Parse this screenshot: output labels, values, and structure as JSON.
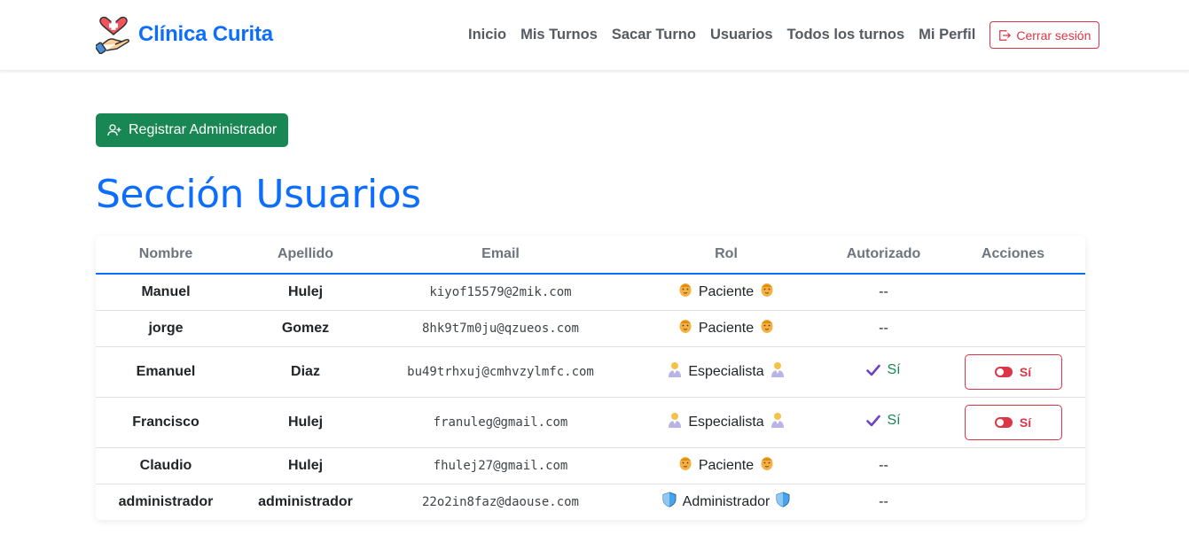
{
  "brand": {
    "name": "Clínica Curita",
    "logo_icon": "heart-hand-icon"
  },
  "nav": {
    "links": [
      "Inicio",
      "Mis Turnos",
      "Sacar Turno",
      "Usuarios",
      "Todos los turnos",
      "Mi Perfil"
    ],
    "logout_label": "Cerrar sesión"
  },
  "register_button": {
    "label": "Registrar Administrador",
    "icon": "person-plus-icon"
  },
  "page_title": "Sección Usuarios",
  "table": {
    "headers": [
      "Nombre",
      "Apellido",
      "Email",
      "Rol",
      "Autorizado",
      "Acciones"
    ],
    "rows": [
      {
        "name": "Manuel",
        "surname": "Hulej",
        "email": "kiyof15579@2mik.com",
        "rol": "Paciente",
        "rol_icon": "patient-emoji-icon",
        "authorized": "--",
        "action": null
      },
      {
        "name": "jorge",
        "surname": "Gomez",
        "email": "8hk9t7m0ju@qzueos.com",
        "rol": "Paciente",
        "rol_icon": "patient-emoji-icon",
        "authorized": "--",
        "action": null
      },
      {
        "name": "Emanuel",
        "surname": "Diaz",
        "email": "bu49trhxuj@cmhvzylmfc.com",
        "rol": "Especialista",
        "rol_icon": "doctor-emoji-icon",
        "authorized": "Sí",
        "action": "Sí"
      },
      {
        "name": "Francisco",
        "surname": "Hulej",
        "email": "franuleg@gmail.com",
        "rol": "Especialista",
        "rol_icon": "doctor-emoji-icon",
        "authorized": "Sí",
        "action": "Sí"
      },
      {
        "name": "Claudio",
        "surname": "Hulej",
        "email": "fhulej27@gmail.com",
        "rol": "Paciente",
        "rol_icon": "patient-emoji-icon",
        "authorized": "--",
        "action": null
      },
      {
        "name": "administrador",
        "surname": "administrador",
        "email": "22o2in8faz@daouse.com",
        "rol": "Administrador",
        "rol_icon": "shield-icon",
        "authorized": "--",
        "action": null
      }
    ]
  },
  "colors": {
    "primary": "#0d6efd",
    "success": "#198754",
    "danger": "#dc3545",
    "muted": "#6c757d"
  }
}
